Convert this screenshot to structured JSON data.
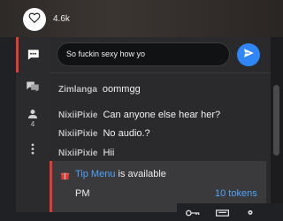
{
  "header": {
    "like_count": "4.6k"
  },
  "sidebar": {
    "users_count": "4"
  },
  "chat_input": {
    "value": "So fuckin sexy how yo"
  },
  "messages": [
    {
      "user": "Zimlanga",
      "text": "oommgg"
    },
    {
      "user": "NixiiPixie",
      "text": "Can anyone else hear her?"
    },
    {
      "user": "NixiiPixie",
      "text": "No audio.?"
    },
    {
      "user": "NixiiPixie",
      "text": "Hii"
    }
  ],
  "tip_menu": {
    "link": "Tip Menu",
    "suffix": " is available",
    "item": "PM",
    "price": "10 tokens"
  },
  "colors": {
    "accent_red": "#e53935",
    "link_blue": "#4fa3f7",
    "send_blue": "#2f86f6"
  },
  "icons": [
    "heart-icon",
    "chat-icon",
    "private-chat-icon",
    "users-icon",
    "more-icon",
    "send-icon",
    "gift-icon"
  ]
}
